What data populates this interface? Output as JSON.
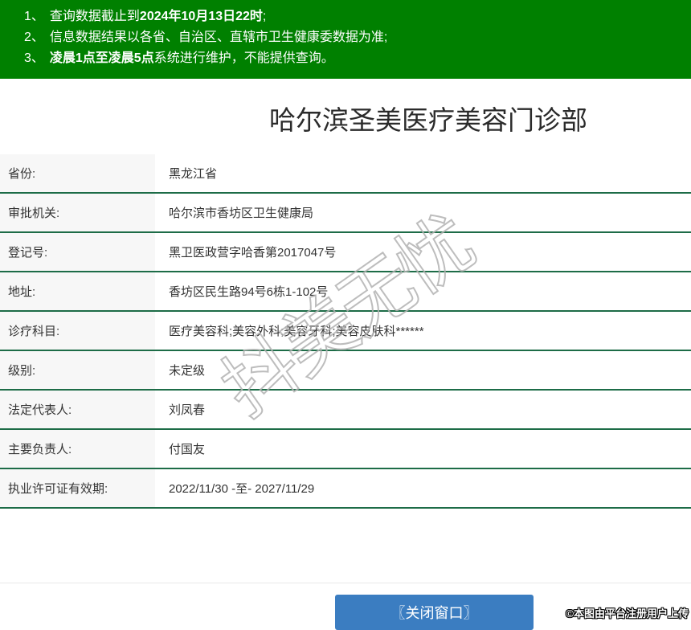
{
  "notice": {
    "items": [
      {
        "num": "1、",
        "pre": "查询数据截止到",
        "bold": "2024年10月13日22时",
        "post": ";"
      },
      {
        "num": "2、",
        "pre": "信息数据结果以各省、自治区、直辖市卫生健康委数据为准;",
        "bold": "",
        "post": ""
      },
      {
        "num": "3、",
        "pre": "",
        "bold": "凌晨1点至凌晨5点",
        "post": "系统进行维护，不能提供查询。"
      }
    ]
  },
  "title": "哈尔滨圣美医疗美容门诊部",
  "table": {
    "rows": [
      {
        "label": "省份:",
        "value": "黑龙江省"
      },
      {
        "label": "审批机关:",
        "value": "哈尔滨市香坊区卫生健康局"
      },
      {
        "label": "登记号:",
        "value": "黑卫医政营字哈香第2017047号"
      },
      {
        "label": "地址:",
        "value": "香坊区民生路94号6栋1-102号"
      },
      {
        "label": "诊疗科目:",
        "value": "医疗美容科;美容外科;美容牙科;美容皮肤科******"
      },
      {
        "label": "级别:",
        "value": "未定级"
      },
      {
        "label": "法定代表人:",
        "value": "刘凤春"
      },
      {
        "label": "主要负责人:",
        "value": "付国友"
      },
      {
        "label": "执业许可证有效期:",
        "value": "2022/11/30 -至- 2027/11/29"
      }
    ]
  },
  "watermark": "抖美无忧",
  "footer": {
    "close_button": "〖关闭窗口〗",
    "note": "©本图由平台注册用户上传"
  },
  "colors": {
    "header_green": "#008000",
    "separator_green": "#1d6c47",
    "label_bg": "#f7f7f7",
    "button_blue": "#3b7dc1",
    "title_text": "#2b2b2b",
    "body_text": "#333333"
  }
}
